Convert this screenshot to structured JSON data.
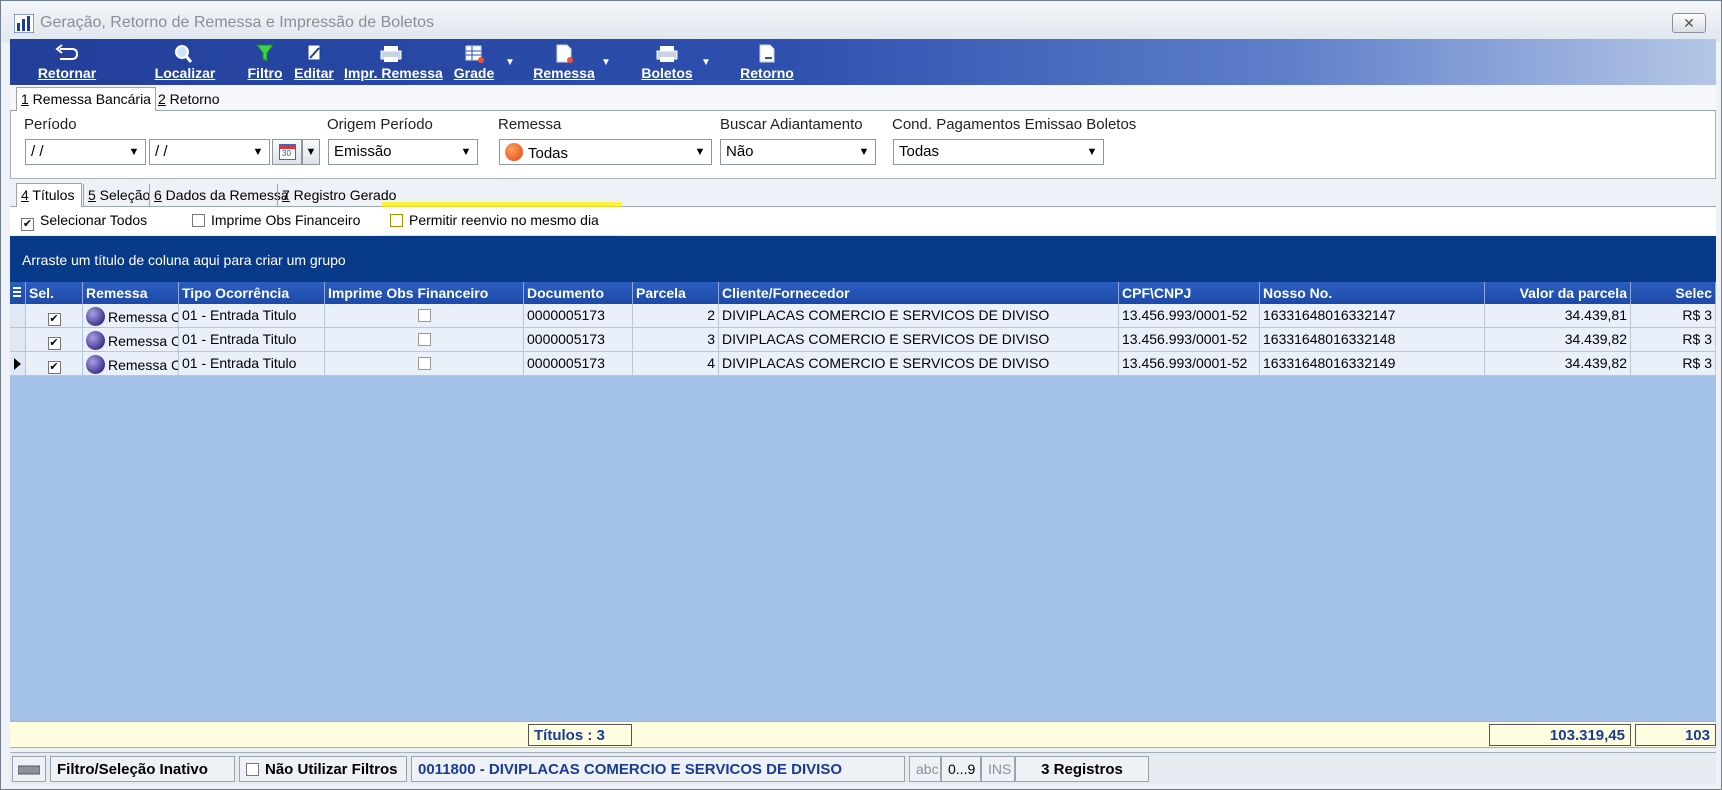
{
  "window": {
    "title": "Geração, Retorno de Remessa e Impressão de Boletos",
    "close_label": "✕"
  },
  "toolbar": {
    "retornar": "Retornar",
    "localizar": "Localizar",
    "filtro": "Filtro",
    "editar": "Editar",
    "impr_remessa": "Impr. Remessa",
    "grade": "Grade",
    "remessa": "Remessa",
    "boletos": "Boletos",
    "retorno": "Retorno"
  },
  "main_tabs": [
    {
      "key": "1",
      "label": " Remessa Bancária"
    },
    {
      "key": "2",
      "label": " Retorno"
    }
  ],
  "filters": {
    "periodo_label": "Período",
    "periodo_inicio": " / /",
    "periodo_fim": " / /",
    "origem_label": "Origem Período",
    "origem_value": "Emissão",
    "remessa_label": "Remessa",
    "remessa_value": "Todas",
    "adiantamento_label": "Buscar Adiantamento",
    "adiantamento_value": "Não",
    "cond_label": "Cond. Pagamentos Emissao Boletos",
    "cond_value": "Todas",
    "calendar_day": "30"
  },
  "sub_tabs": [
    {
      "key": "4",
      "label": " Títulos"
    },
    {
      "key": "5",
      "label": " Seleção"
    },
    {
      "key": "6",
      "label": " Dados da Remessa"
    },
    {
      "key": "7",
      "label": " Registro Gerado"
    }
  ],
  "options": {
    "selecionar_todos": "Selecionar Todos",
    "imprime_obs": "Imprime Obs Financeiro",
    "permitir_reenvio": "Permitir reenvio no mesmo dia"
  },
  "group_panel_text": "Arraste um título de coluna aqui para criar um grupo",
  "grid": {
    "columns": [
      "Sel.",
      "Remessa",
      "Tipo Ocorrência",
      "Imprime Obs Financeiro",
      "Documento",
      "Parcela",
      "Cliente/Fornecedor",
      "CPF\\CNPJ",
      "Nosso No.",
      "Valor da parcela",
      "Selec"
    ],
    "rows": [
      {
        "remessa": "Remessa C",
        "tipo": "01 - Entrada Titulo",
        "documento": "0000005173",
        "parcela": "2",
        "cliente": "DIVIPLACAS COMERCIO E SERVICOS DE DIVISO",
        "cnpj": "13.456.993/0001-52",
        "nosso": "16331648016332147",
        "valor": "34.439,81",
        "selec": "R$ 3"
      },
      {
        "remessa": "Remessa C",
        "tipo": "01 - Entrada Titulo",
        "documento": "0000005173",
        "parcela": "3",
        "cliente": "DIVIPLACAS COMERCIO E SERVICOS DE DIVISO",
        "cnpj": "13.456.993/0001-52",
        "nosso": "16331648016332148",
        "valor": "34.439,82",
        "selec": "R$ 3"
      },
      {
        "remessa": "Remessa C",
        "tipo": "01 - Entrada Titulo",
        "documento": "0000005173",
        "parcela": "4",
        "cliente": "DIVIPLACAS COMERCIO E SERVICOS DE DIVISO",
        "cnpj": "13.456.993/0001-52",
        "nosso": "16331648016332149",
        "valor": "34.439,82",
        "selec": "R$ 3"
      }
    ]
  },
  "footer": {
    "titulos": "Títulos : 3",
    "total_valor": "103.319,45",
    "total_selec": "103"
  },
  "status": {
    "filtro": "Filtro/Seleção Inativo",
    "nao_utilizar": "Não Utilizar Filtros",
    "cliente": "0011800 - DIVIPLACAS COMERCIO E SERVICOS DE DIVISO",
    "abc": "abc",
    "num": "0...9",
    "ins": "INS",
    "registros": "3 Registros"
  }
}
